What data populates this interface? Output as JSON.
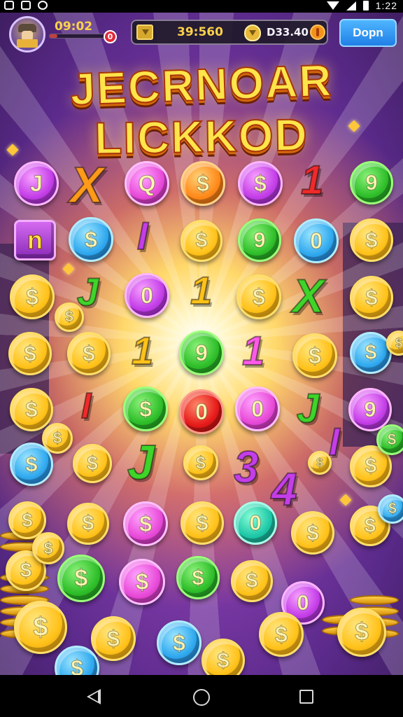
{
  "status_bar": {
    "time": "1:22"
  },
  "hud": {
    "timer": "09:02",
    "xp_progress": 0.12,
    "notification_count": "0",
    "currency1": "39:560",
    "currency2": "D33.40",
    "open_button": "Dopn"
  },
  "title": {
    "line1": "JECRNOAR",
    "line2": "LICKKOD"
  },
  "tokens": [
    {
      "kind": "coin",
      "color": "purple",
      "symbol": "J"
    },
    {
      "kind": "letter",
      "color": "orange",
      "symbol": "X"
    },
    {
      "kind": "coin",
      "color": "pink",
      "symbol": "Q"
    },
    {
      "kind": "coin",
      "color": "orange",
      "symbol": "$"
    },
    {
      "kind": "coin",
      "color": "purple",
      "symbol": "$"
    },
    {
      "kind": "letter",
      "color": "red",
      "symbol": "1"
    },
    {
      "kind": "coin",
      "color": "green",
      "symbol": "9"
    },
    {
      "kind": "block",
      "color": "purple",
      "symbol": "n"
    },
    {
      "kind": "coin",
      "color": "blue",
      "symbol": "$"
    },
    {
      "kind": "letter",
      "color": "purple",
      "symbol": "I"
    },
    {
      "kind": "coin",
      "color": "gold",
      "symbol": "$"
    },
    {
      "kind": "coin",
      "color": "green",
      "symbol": "9"
    },
    {
      "kind": "coin",
      "color": "blue",
      "symbol": "0"
    },
    {
      "kind": "coin",
      "color": "gold",
      "symbol": "$"
    },
    {
      "kind": "coin",
      "color": "gold",
      "symbol": "$"
    },
    {
      "kind": "letter",
      "color": "green",
      "symbol": "J"
    },
    {
      "kind": "coin",
      "color": "purple",
      "symbol": "0"
    },
    {
      "kind": "letter",
      "color": "gold",
      "symbol": "1"
    },
    {
      "kind": "coin",
      "color": "gold",
      "symbol": "$"
    },
    {
      "kind": "letter",
      "color": "green",
      "symbol": "X"
    },
    {
      "kind": "coin",
      "color": "gold",
      "symbol": "$"
    },
    {
      "kind": "coin",
      "color": "gold",
      "symbol": "$"
    },
    {
      "kind": "coin",
      "color": "gold",
      "symbol": "$"
    },
    {
      "kind": "coin",
      "color": "gold",
      "symbol": "$"
    },
    {
      "kind": "letter",
      "color": "gold",
      "symbol": "1"
    },
    {
      "kind": "coin",
      "color": "green",
      "symbol": "9"
    },
    {
      "kind": "letter",
      "color": "pink",
      "symbol": "1"
    },
    {
      "kind": "coin",
      "color": "gold",
      "symbol": "$"
    },
    {
      "kind": "coin",
      "color": "blue",
      "symbol": "$"
    },
    {
      "kind": "coin",
      "color": "gold",
      "symbol": "$"
    },
    {
      "kind": "coin",
      "color": "gold",
      "symbol": "$"
    },
    {
      "kind": "letter",
      "color": "red",
      "symbol": "I"
    },
    {
      "kind": "coin",
      "color": "green",
      "symbol": "$"
    },
    {
      "kind": "coin",
      "color": "red",
      "symbol": "0"
    },
    {
      "kind": "coin",
      "color": "pink",
      "symbol": "0"
    },
    {
      "kind": "letter",
      "color": "green",
      "symbol": "J"
    },
    {
      "kind": "coin",
      "color": "purple",
      "symbol": "9"
    },
    {
      "kind": "coin",
      "color": "gold",
      "symbol": "$"
    },
    {
      "kind": "coin",
      "color": "blue",
      "symbol": "$"
    },
    {
      "kind": "coin",
      "color": "gold",
      "symbol": "$"
    },
    {
      "kind": "letter",
      "color": "green",
      "symbol": "J"
    },
    {
      "kind": "coin",
      "color": "gold",
      "symbol": "$"
    },
    {
      "kind": "letter",
      "color": "purple",
      "symbol": "3"
    },
    {
      "kind": "letter",
      "color": "purple",
      "symbol": "4"
    },
    {
      "kind": "coin",
      "color": "gold",
      "symbol": "$"
    },
    {
      "kind": "letter",
      "color": "purple",
      "symbol": "I"
    },
    {
      "kind": "coin",
      "color": "gold",
      "symbol": "$"
    },
    {
      "kind": "coin",
      "color": "green",
      "symbol": "$"
    },
    {
      "kind": "coin",
      "color": "gold",
      "symbol": "$"
    },
    {
      "kind": "coin",
      "color": "gold",
      "symbol": "$"
    },
    {
      "kind": "coin",
      "color": "pink",
      "symbol": "$"
    },
    {
      "kind": "coin",
      "color": "gold",
      "symbol": "$"
    },
    {
      "kind": "coin",
      "color": "teal",
      "symbol": "0"
    },
    {
      "kind": "coin",
      "color": "gold",
      "symbol": "$"
    },
    {
      "kind": "coin",
      "color": "gold",
      "symbol": "$"
    },
    {
      "kind": "coin",
      "color": "blue",
      "symbol": "$"
    },
    {
      "kind": "coin",
      "color": "gold",
      "symbol": "$"
    },
    {
      "kind": "coin",
      "color": "gold",
      "symbol": "$"
    },
    {
      "kind": "coin",
      "color": "green",
      "symbol": "$"
    },
    {
      "kind": "coin",
      "color": "pink",
      "symbol": "$"
    },
    {
      "kind": "coin",
      "color": "green",
      "symbol": "$"
    },
    {
      "kind": "coin",
      "color": "gold",
      "symbol": "$"
    },
    {
      "kind": "coin",
      "color": "purple",
      "symbol": "0"
    },
    {
      "kind": "coin",
      "color": "gold",
      "symbol": "$"
    },
    {
      "kind": "coin",
      "color": "gold",
      "symbol": "$"
    },
    {
      "kind": "coin",
      "color": "blue",
      "symbol": "$"
    },
    {
      "kind": "coin",
      "color": "gold",
      "symbol": "$"
    },
    {
      "kind": "coin",
      "color": "gold",
      "symbol": "$"
    },
    {
      "kind": "coin",
      "color": "gold",
      "symbol": "$"
    },
    {
      "kind": "coin",
      "color": "blue",
      "symbol": "$"
    }
  ],
  "colors": {
    "accent_gold": "#ffc21a",
    "button_blue": "#1f7fe6",
    "background_purple": "#5a2a8a"
  }
}
